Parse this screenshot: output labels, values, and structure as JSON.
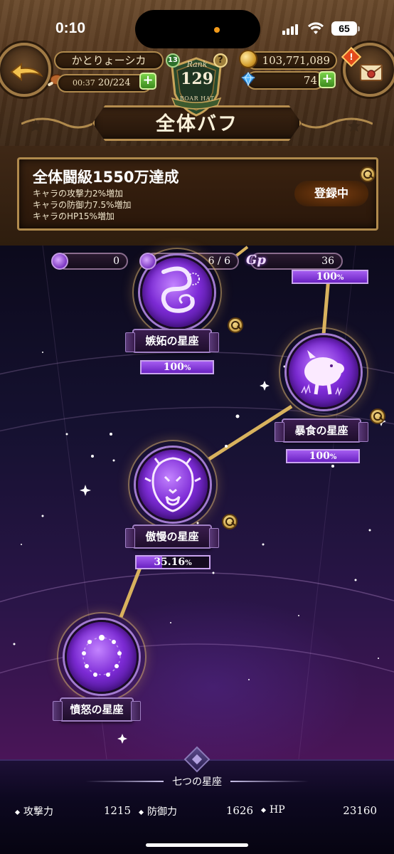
{
  "status_bar": {
    "time": "0:10",
    "battery": "65"
  },
  "header": {
    "player_name": "かとりょーシカ",
    "stamina_timer": "00:37",
    "stamina": "20/224",
    "rank_label": "Rank",
    "rank_value": "129",
    "rank_level": "13",
    "rank_help": "?",
    "rank_banner": "BOAR HAT",
    "gold": "103,771,089",
    "gems": "74",
    "alert": "!"
  },
  "title": "全体バフ",
  "buff": {
    "title": "全体闘級1550万達成",
    "lines": [
      "キャラの攻撃力2%増加",
      "キャラの防御力7.5%増加",
      "キャラのHP15%増加"
    ],
    "status": "登録中"
  },
  "resources": {
    "res1": "0",
    "res2": "6 / 6",
    "gp_label": "Gp",
    "gp": "36"
  },
  "constellations": [
    {
      "label": "嫉妬の星座",
      "percent": 100,
      "percent_text": "100",
      "icon": "serpent-icon"
    },
    {
      "label": "暴食の星座",
      "percent": 100,
      "percent_text": "100",
      "icon": "boar-icon"
    },
    {
      "label": "傲慢の星座",
      "percent": 35.16,
      "percent_text": "35.16",
      "icon": "lion-icon"
    },
    {
      "label": "憤怒の星座",
      "icon": "dragon-star-icon"
    }
  ],
  "top_partial": {
    "percent_text": "100",
    "percent": 100
  },
  "percent_sign": "%",
  "bottom": {
    "set_title": "七つの星座",
    "stats": [
      {
        "label": "攻撃力",
        "value": "1215"
      },
      {
        "label": "防御力",
        "value": "1626"
      },
      {
        "label": "HP",
        "value": "23160"
      }
    ]
  },
  "colors": {
    "accent_gold": "#b08a4d",
    "accent_purple": "#a45cf0",
    "plus_green": "#7ad34a"
  }
}
